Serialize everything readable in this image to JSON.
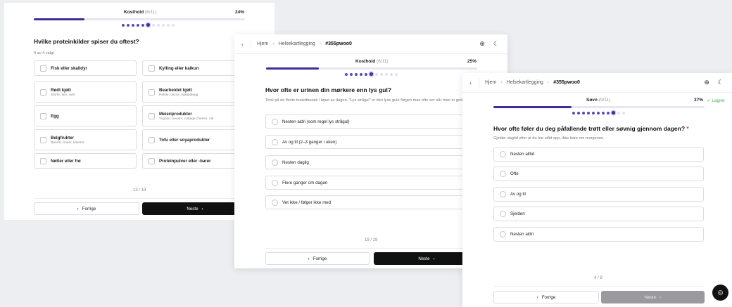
{
  "card1": {
    "section": "Kosthold",
    "section_sub": "(6/11)",
    "percent": "24%",
    "progress": 0.24,
    "dots": {
      "total": 11,
      "current": 6
    },
    "question": "Hvilke proteinkilder spiser du oftest?",
    "selected_count": "0 av 4 valgt",
    "options": [
      {
        "title": "Fisk eller skalldyr",
        "sub": ""
      },
      {
        "title": "Kylling eller kalkun",
        "sub": ""
      },
      {
        "title": "Rødt kjøtt",
        "sub": "Storfe, lam, svin"
      },
      {
        "title": "Bearbeidet kjøtt",
        "sub": "Pølser, bacon, kjøttpålegg"
      },
      {
        "title": "Egg",
        "sub": ""
      },
      {
        "title": "Meieriprodukter",
        "sub": "Yoghurt, kesam, cottage cheese, ost"
      },
      {
        "title": "Belgfrukter",
        "sub": "Bønner, linser, kikerter"
      },
      {
        "title": "Tofu eller soyaprodukter",
        "sub": ""
      },
      {
        "title": "Nøtter eller frø",
        "sub": ""
      },
      {
        "title": "Proteinpulver eller -barer",
        "sub": ""
      }
    ],
    "counter": "13 / 19",
    "prev_label": "Forrige",
    "next_label": "Neste"
  },
  "card2": {
    "breadcrumb": {
      "home": "Hjem",
      "middle": "Helsekartlegging",
      "current": "#355pwoo0"
    },
    "section": "Kosthold",
    "section_sub": "(6/11)",
    "percent": "25%",
    "progress": 0.25,
    "dots": {
      "total": 11,
      "current": 6
    },
    "question": "Hvor ofte er urinen din mørkere enn lys gul?",
    "hint": "Tenk på de fleste toalettbesøk i løpet av dagen. \"Lys strågul\" er den lyse gule fargen man ofte ser når man er godt hydrert.",
    "options": [
      "Nesten aldri (som regel lys strågul)",
      "Av og til (2–3 ganger i uken)",
      "Nesten daglig",
      "Flere ganger om dagen",
      "Vet ikke / følger ikke med"
    ],
    "counter": "19 / 19",
    "prev_label": "Forrige",
    "next_label": "Neste"
  },
  "card3": {
    "breadcrumb": {
      "home": "Hjem",
      "middle": "Helsekartlegging",
      "current": "#355pwoo0"
    },
    "section": "Søvn",
    "section_sub": "(9/11)",
    "percent": "37%",
    "progress": 0.37,
    "saved": "✓ Lagret",
    "dots": {
      "total": 11,
      "current": 9
    },
    "question": "Hvor ofte føler du deg påfallende trøtt eller søvnig gjennom dagen?",
    "required_mark": "*",
    "hint": "Gjelder dagtid etter at du har stått opp, ikke bare om morgenen.",
    "options": [
      "Nesten alltid",
      "Ofte",
      "Av og til",
      "Sjelden",
      "Nesten aldri"
    ],
    "counter": "4 / 8",
    "prev_label": "Forrige",
    "next_label": "Neste"
  },
  "icons": {
    "back": "chevron-left-icon",
    "globe": "globe-icon",
    "theme": "moon-icon",
    "chat": "chat-icon"
  }
}
